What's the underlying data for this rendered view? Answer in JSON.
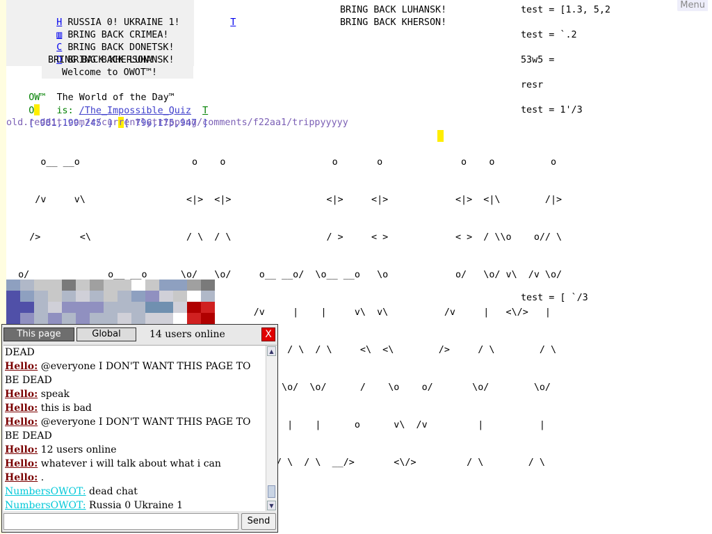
{
  "menu": {
    "label": "Menu"
  },
  "left_panel": {
    "header_line": "H RUSSIA 0! UKRAINE 1!",
    "links": [
      {
        "key": "H",
        "text": "RUSSIA 0! UKRAINE 1!"
      },
      {
        "key": "",
        "text": "BRING BACK CRIMEA!"
      },
      {
        "key": "C",
        "text": "BRING BACK DONETSK!"
      },
      {
        "key": "D",
        "text": "BRING BACK LUHANSK!"
      },
      {
        "key": "",
        "text": "BRING BACK KHERSON!"
      }
    ],
    "t_link": "T",
    "welcome": "Welcome to OWOT™!",
    "owotd_prefix": "OW™",
    "owotd_title": "The World of the Day™",
    "is_label": "O    is:",
    "quiz_link": "/The_Impossible_Quiz",
    "t_link2": "T",
    "coords_a": "[ 981,199,245 ]",
    "coords_b": "[ 796,175,947 ]",
    "reddit_url": "old.reddit.com/r/currentlytripping/comments/f22aa1/trippyyyyy"
  },
  "center_text": [
    "BRING BACK LUHANSK!",
    "BRING BACK KHERSON!"
  ],
  "right_text": [
    "test = [1.3, 5,2",
    "test = `.2",
    "53w5 =",
    "resr",
    "test = 1'/3",
    "test = [ `/3"
  ],
  "ascii_art": [
    "      o__ __o                    o    o                   o       o              o    o          o",
    "     /v     v\\                  <|>  <|>                 <|>     <|>            <|>  <|\\        /|>",
    "    />       <\\                 / \\  / \\                 / >     < >            < >  / \\\\o    o// \\",
    "  o/              o__ __o      \\o/   \\o/     o__ __o/  \\o__ __o   \\o            o/   \\o/ v\\  /v \\o/",
    " <|              /v     v\\      |     |     /v     |    |     v\\  v\\          /v     |   <\\/>   |",
    "  \\\\            />       <\\    / \\   / \\   />     / \\  / \\     <\\  <\\        />     / \\        / \\",
    "    \\         /  \\         /  \\o/   \\o/   \\      \\o/  \\o/      /    \\o    o/       \\o/        \\o/",
    "     o       o    o       o    |     |     o      |    |      o      v\\  /v         |          |",
    "     <\\__ __/>    <\\__ __/>   / \\   / \\   <\\__  / \\  / \\  __/>       <\\/>         / \\        / \\"
  ],
  "chat": {
    "tab_this": "This page",
    "tab_global": "Global",
    "users_online": "14 users online",
    "close": "X",
    "send": "Send",
    "input_placeholder": "",
    "messages": [
      {
        "nick": "",
        "text": "DEAD"
      },
      {
        "nick": "Hello:",
        "text": "@everyone I DON'T WANT THIS PAGE TO BE DEAD"
      },
      {
        "nick": "Hello:",
        "text": "speak"
      },
      {
        "nick": "Hello:",
        "text": "this is bad"
      },
      {
        "nick": "Hello:",
        "text": "@everyone I DON'T WANT THIS PAGE TO BE DEAD"
      },
      {
        "nick": "Hello:",
        "text": "12 users online"
      },
      {
        "nick": "Hello:",
        "text": "whatever i will talk about what i can"
      },
      {
        "nick": "Hello:",
        "text": "."
      },
      {
        "nick": "NumbersOWOT:",
        "text": "dead chat"
      },
      {
        "nick": "NumbersOWOT:",
        "text": "Russia 0 Ukraine 1"
      }
    ]
  }
}
